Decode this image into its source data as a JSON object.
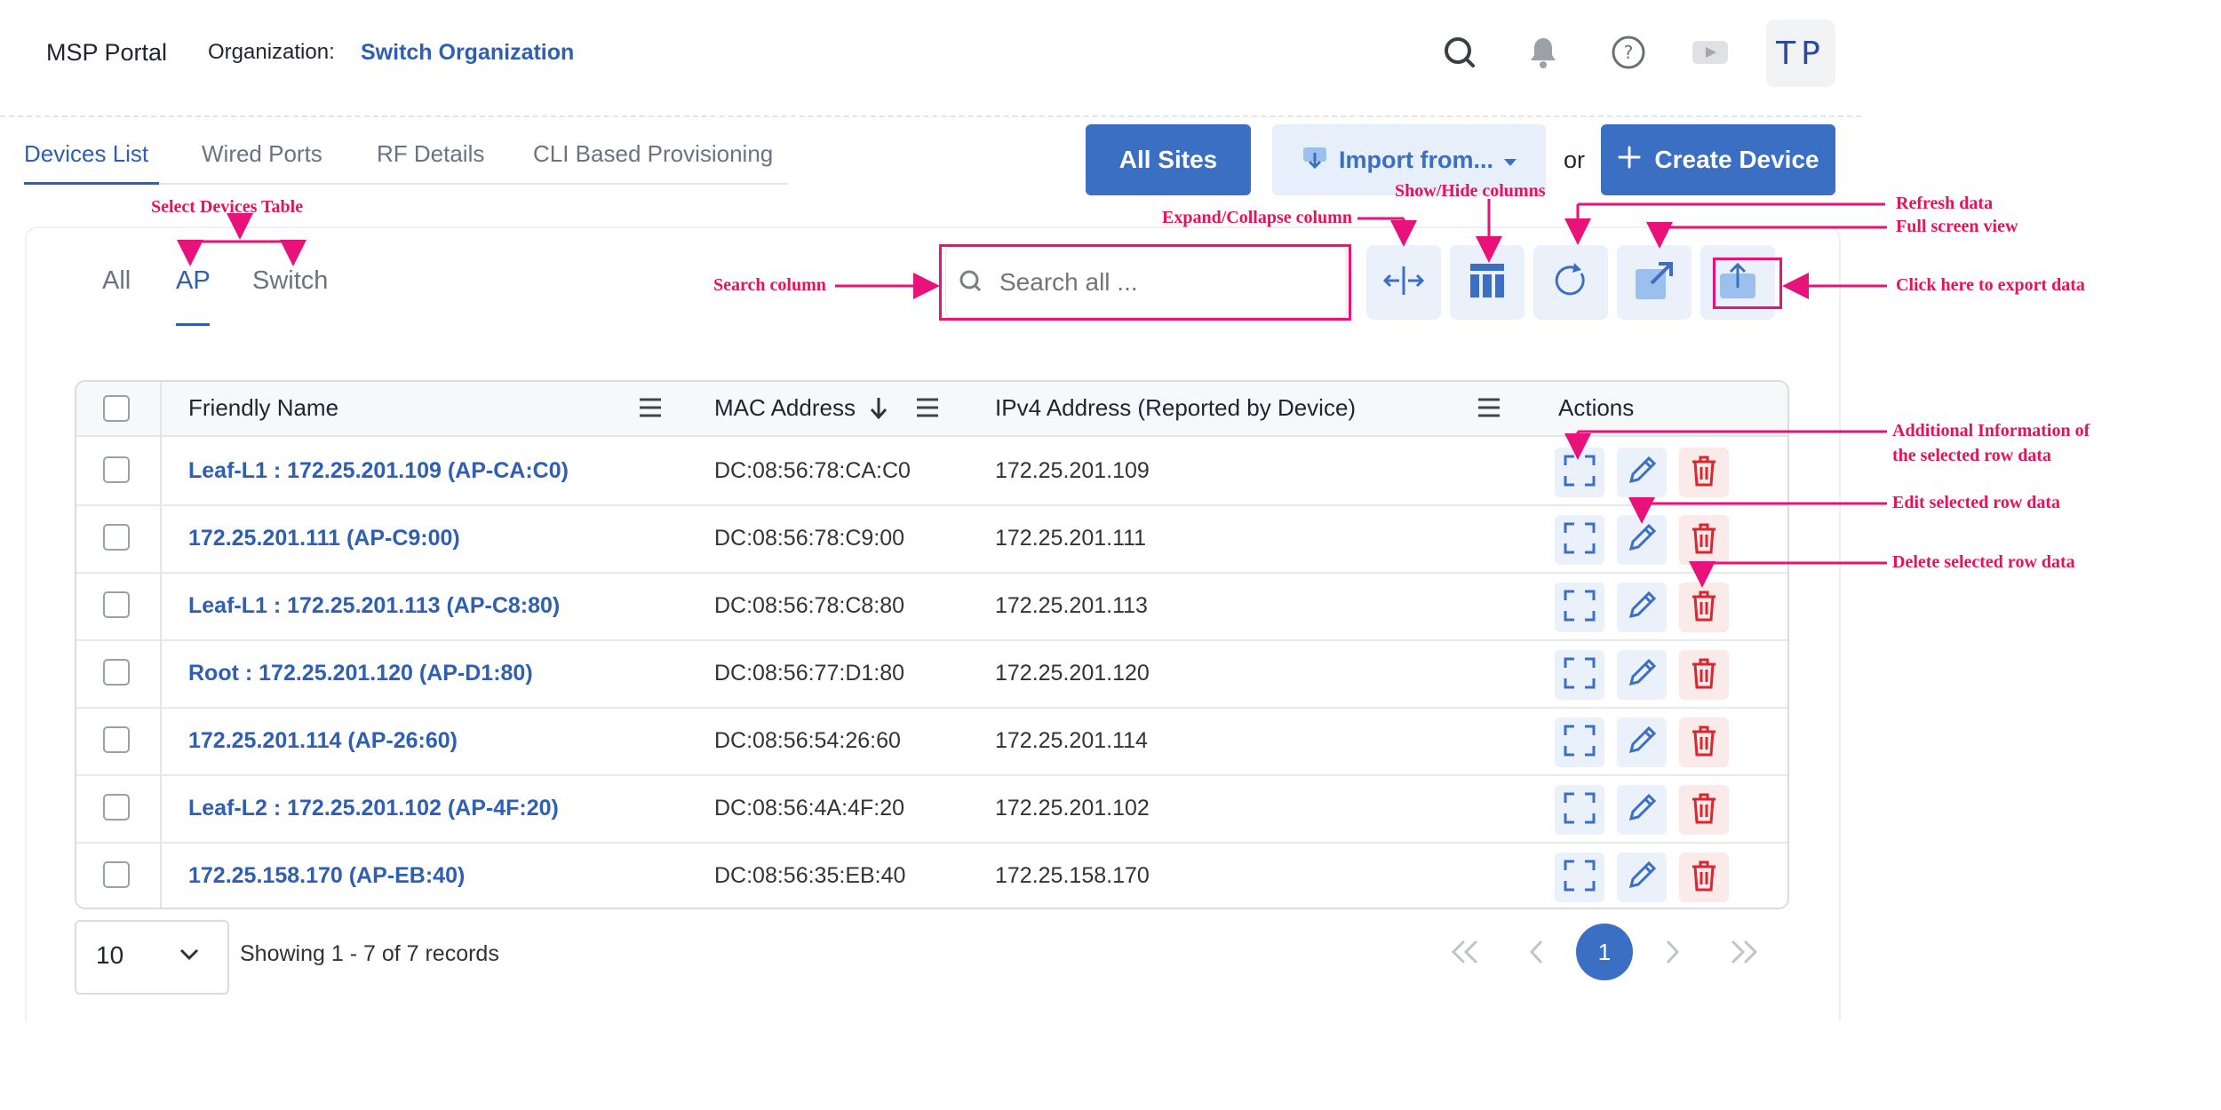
{
  "header": {
    "brand": "MSP Portal",
    "org_label": "Organization:",
    "org_name": "Switch Organization",
    "avatar_initials": "TP"
  },
  "tabs": [
    {
      "label": "Devices List",
      "active": true
    },
    {
      "label": "Wired Ports",
      "active": false
    },
    {
      "label": "RF Details",
      "active": false
    },
    {
      "label": "CLI Based Provisioning",
      "active": false
    }
  ],
  "actions": {
    "all_sites": "All Sites",
    "import": "Import from...",
    "or": "or",
    "create": "Create Device"
  },
  "filters": [
    {
      "label": "All",
      "active": false
    },
    {
      "label": "AP",
      "active": true
    },
    {
      "label": "Switch",
      "active": false
    }
  ],
  "search": {
    "placeholder": "Search all ..."
  },
  "table": {
    "columns": [
      "Friendly Name",
      "MAC Address",
      "IPv4 Address (Reported by Device)",
      "Actions"
    ],
    "rows": [
      {
        "name": "Leaf-L1 : 172.25.201.109 (AP-CA:C0)",
        "mac": "DC:08:56:78:CA:C0",
        "ip": "172.25.201.109"
      },
      {
        "name": "172.25.201.111 (AP-C9:00)",
        "mac": "DC:08:56:78:C9:00",
        "ip": "172.25.201.111"
      },
      {
        "name": "Leaf-L1 : 172.25.201.113 (AP-C8:80)",
        "mac": "DC:08:56:78:C8:80",
        "ip": "172.25.201.113"
      },
      {
        "name": "Root : 172.25.201.120 (AP-D1:80)",
        "mac": "DC:08:56:77:D1:80",
        "ip": "172.25.201.120"
      },
      {
        "name": "172.25.201.114 (AP-26:60)",
        "mac": "DC:08:56:54:26:60",
        "ip": "172.25.201.114"
      },
      {
        "name": "Leaf-L2 : 172.25.201.102 (AP-4F:20)",
        "mac": "DC:08:56:4A:4F:20",
        "ip": "172.25.201.102"
      },
      {
        "name": "172.25.158.170 (AP-EB:40)",
        "mac": "DC:08:56:35:EB:40",
        "ip": "172.25.158.170"
      }
    ]
  },
  "footer": {
    "page_size": "10",
    "records": "Showing 1 - 7 of 7 records",
    "current_page": "1"
  },
  "annotations": {
    "select_devices_table": "Select Devices Table",
    "search_column": "Search column",
    "expand_collapse": "Expand/Collapse column",
    "show_hide": "Show/Hide columns",
    "refresh": "Refresh data",
    "full_screen": "Full screen view",
    "export": "Click here to export data",
    "additional_info_1": "Additional Information of",
    "additional_info_2": "the selected row data",
    "edit": "Edit selected row data",
    "delete": "Delete selected row data"
  },
  "colors": {
    "accent": "#3a6fc4",
    "link": "#2e5fb3",
    "annotation": "#e8125c",
    "danger": "#d9262f"
  }
}
